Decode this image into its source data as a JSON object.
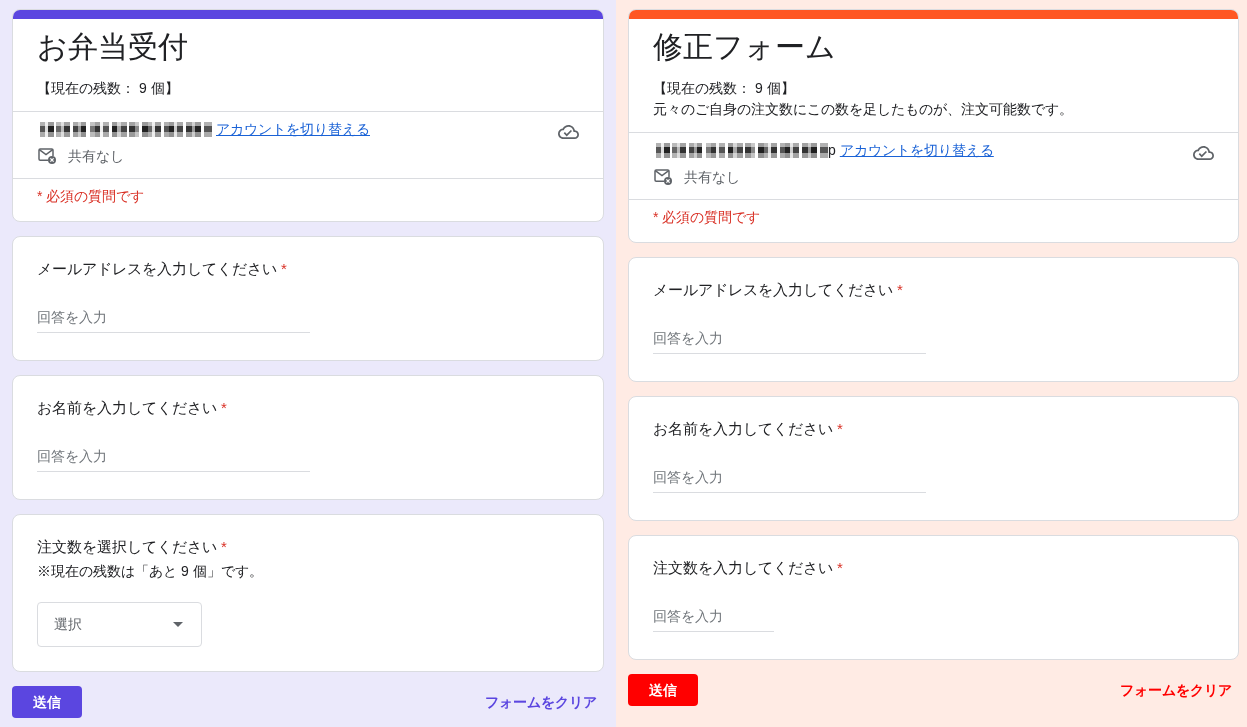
{
  "forms": [
    {
      "color": "#5b46e0",
      "title": "お弁当受付",
      "description": [
        "【現在の残数： 9 個】"
      ],
      "account": {
        "switch_link": "アカウントを切り替える"
      },
      "sharing": "共有なし",
      "required_note": "* 必須の質問です",
      "questions": [
        {
          "kind": "text",
          "label": "メールアドレスを入力してください",
          "required_mark": "*",
          "placeholder": "回答を入力"
        },
        {
          "kind": "text",
          "label": "お名前を入力してください",
          "required_mark": "*",
          "placeholder": "回答を入力"
        },
        {
          "kind": "dropdown",
          "label": "注文数を選択してください",
          "required_mark": "*",
          "note": "※現在の残数は「あと 9 個」です。",
          "placeholder": "選択"
        }
      ],
      "submit_button": {
        "label": "送信",
        "color": "#5b46e0"
      },
      "clear_button": "フォームをクリア"
    },
    {
      "color": "#ff5722",
      "title": "修正フォーム",
      "description": [
        "【現在の残数： 9 個】",
        "元々のご自身の注文数にこの数を足したものが、注文可能数です。"
      ],
      "account": {
        "email_tail": "p",
        "switch_link": "アカウントを切り替える"
      },
      "sharing": "共有なし",
      "required_note": "* 必須の質問です",
      "questions": [
        {
          "kind": "text",
          "label": "メールアドレスを入力してください",
          "required_mark": "*",
          "placeholder": "回答を入力"
        },
        {
          "kind": "text",
          "label": "お名前を入力してください",
          "required_mark": "*",
          "placeholder": "回答を入力"
        },
        {
          "kind": "short",
          "label": "注文数を入力してください",
          "required_mark": "*",
          "placeholder": "回答を入力"
        }
      ],
      "submit_button": {
        "label": "送信",
        "color": "#ff0000"
      },
      "clear_button": "フォームをクリア"
    }
  ]
}
